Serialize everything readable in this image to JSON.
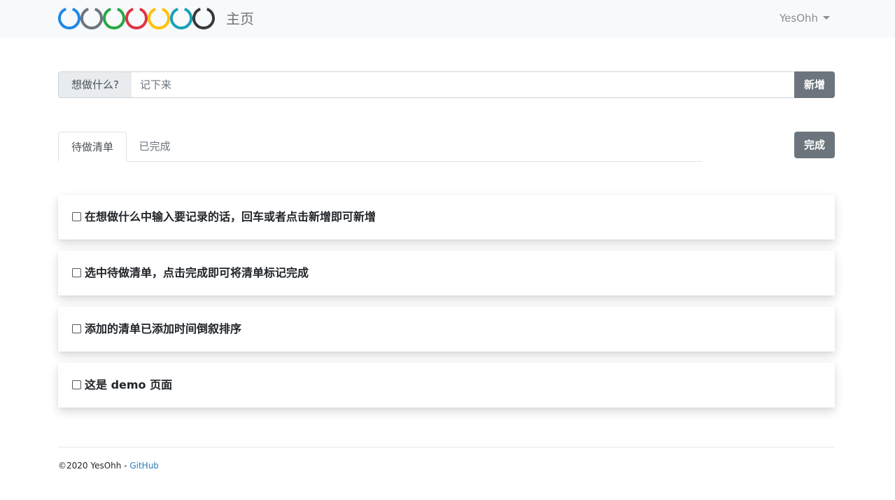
{
  "navbar": {
    "brand_text": "主页",
    "logo_ring_colors": [
      "#1e88e5",
      "#6c757d",
      "#28a745",
      "#dc3545",
      "#ffc107",
      "#17a2b8",
      "#343a40"
    ],
    "user_name": "YesOhh"
  },
  "add_form": {
    "prepend_label": "想做什么?",
    "input_placeholder": "记下来",
    "input_value": "",
    "add_button_label": "新增"
  },
  "tabs": [
    {
      "label": "待做清单",
      "active": true
    },
    {
      "label": "已完成",
      "active": false
    }
  ],
  "complete_button_label": "完成",
  "todos": [
    {
      "text": "在想做什么中输入要记录的话，回车或者点击新增即可新增",
      "checked": false
    },
    {
      "text": "选中待做清单，点击完成即可将清单标记完成",
      "checked": false
    },
    {
      "text": "添加的清单已添加时间倒叙排序",
      "checked": false
    },
    {
      "text": "这是 demo 页面",
      "checked": false
    }
  ],
  "footer": {
    "copyright": "©2020 YesOhh - ",
    "link_label": "GitHub"
  },
  "colors": {
    "navbar_bg": "#f8f9fa",
    "button_secondary": "#6c757d",
    "link": "#2b7bb9"
  }
}
